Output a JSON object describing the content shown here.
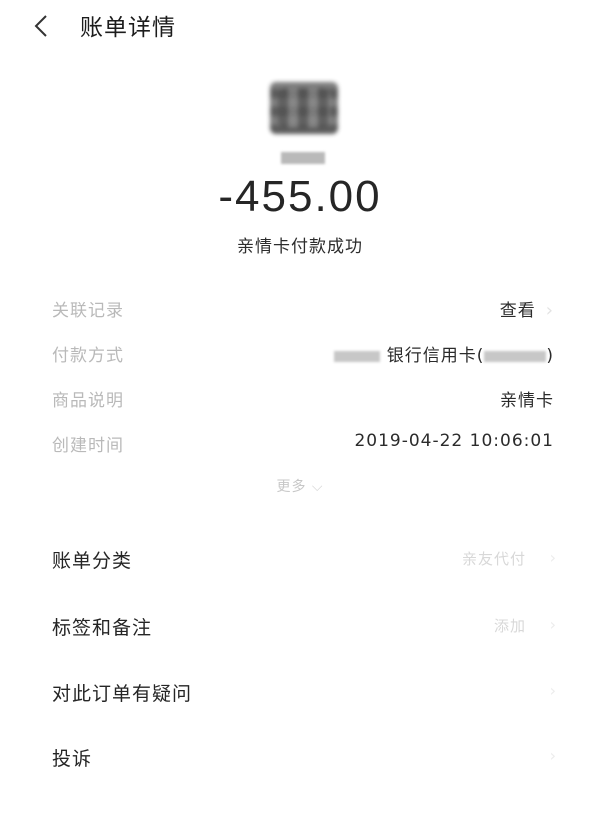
{
  "header": {
    "title": "账单详情"
  },
  "summary": {
    "amount": "-455.00",
    "status": "亲情卡付款成功"
  },
  "details": {
    "related_label": "关联记录",
    "related_value": "查看",
    "payment_label": "付款方式",
    "payment_value_visible": "银行信用卡(",
    "payment_value_close": ")",
    "goods_label": "商品说明",
    "goods_value": "亲情卡",
    "created_label": "创建时间",
    "created_value": "2019-04-22 10:06:01",
    "more_label": "更多"
  },
  "rows": {
    "category_label": "账单分类",
    "category_value": "亲友代付",
    "tags_label": "标签和备注",
    "tags_value": "添加",
    "question_label": "对此订单有疑问",
    "complaint_label": "投诉"
  }
}
